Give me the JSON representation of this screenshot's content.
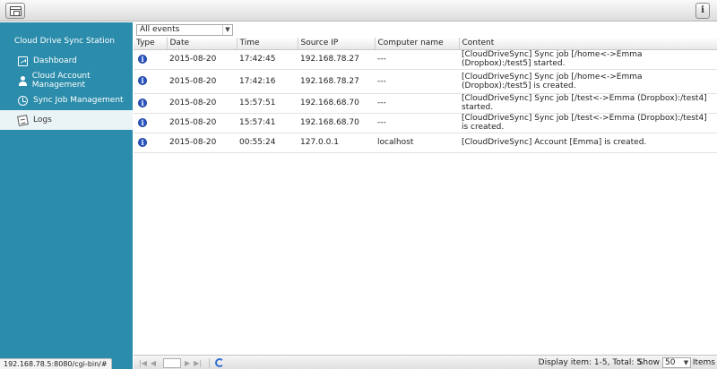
{
  "topbar": {
    "app_icon": "app-window-icon",
    "info_icon": "info-icon",
    "info_glyph": "i"
  },
  "sidebar": {
    "title": "Cloud Drive Sync Station",
    "items": [
      {
        "label": "Dashboard",
        "icon": "dashboard-icon"
      },
      {
        "label": "Cloud Account Management",
        "icon": "user-icon"
      },
      {
        "label": "Sync Job Management",
        "icon": "sync-icon"
      },
      {
        "label": "Logs",
        "icon": "logs-icon",
        "active": true
      }
    ]
  },
  "filter": {
    "selected": "All events"
  },
  "table": {
    "columns": [
      "Type",
      "Date",
      "Time",
      "Source IP",
      "Computer name",
      "Content"
    ],
    "rows": [
      {
        "type": "info",
        "date": "2015-08-20",
        "time": "17:42:45",
        "ip": "192.168.78.27",
        "computer": "---",
        "content": "[CloudDriveSync] Sync job [/home<->Emma (Dropbox):/test5] started."
      },
      {
        "type": "info",
        "date": "2015-08-20",
        "time": "17:42:16",
        "ip": "192.168.78.27",
        "computer": "---",
        "content": "[CloudDriveSync] Sync job [/home<->Emma (Dropbox):/test5] is created."
      },
      {
        "type": "info",
        "date": "2015-08-20",
        "time": "15:57:51",
        "ip": "192.168.68.70",
        "computer": "---",
        "content": "[CloudDriveSync] Sync job [/test<->Emma (Dropbox):/test4] started."
      },
      {
        "type": "info",
        "date": "2015-08-20",
        "time": "15:57:41",
        "ip": "192.168.68.70",
        "computer": "---",
        "content": "[CloudDriveSync] Sync job [/test<->Emma (Dropbox):/test4] is created."
      },
      {
        "type": "info",
        "date": "2015-08-20",
        "time": "00:55:24",
        "ip": "127.0.0.1",
        "computer": "localhost",
        "content": "[CloudDriveSync] Account [Emma] is created."
      }
    ]
  },
  "footer": {
    "display_info": "Display item: 1-5, Total: 5",
    "show_label": "Show",
    "page_size": "50",
    "items_label": "Items"
  },
  "statusbar": {
    "url": "192.168.78.5:8080/cgi-bin/#"
  },
  "colors": {
    "sidebar": "#2b8cab",
    "active_item": "#eaf3f6",
    "info_icon": "#2a55c2"
  }
}
